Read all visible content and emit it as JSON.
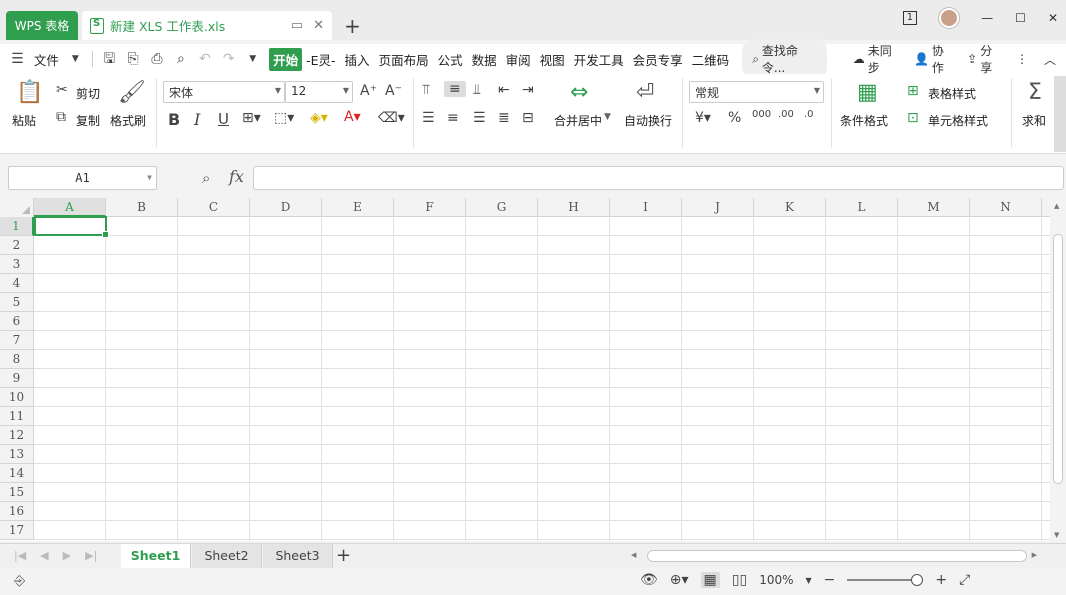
{
  "titlebar": {
    "app_tab": "WPS 表格",
    "doc_tab": "新建 XLS 工作表.xls",
    "tab_count": "1"
  },
  "menubar": {
    "file": "文件",
    "tabs": [
      "开始",
      "-E灵-",
      "插入",
      "页面布局",
      "公式",
      "数据",
      "审阅",
      "视图",
      "开发工具",
      "会员专享",
      "二维码"
    ],
    "search": "查找命令...",
    "sync": "未同步",
    "collab": "协作",
    "share": "分享"
  },
  "ribbon": {
    "paste": "粘贴",
    "cut": "剪切",
    "copy": "复制",
    "format_painter": "格式刷",
    "font_name": "宋体",
    "font_size": "12",
    "merge_center": "合并居中",
    "wrap_text": "自动换行",
    "number_format": "常规",
    "conditional_format": "条件格式",
    "table_style": "表格样式",
    "cell_style": "单元格样式",
    "sum": "求和"
  },
  "formula_bar": {
    "name_box": "A1",
    "fx": "fx"
  },
  "grid": {
    "columns": [
      "A",
      "B",
      "C",
      "D",
      "E",
      "F",
      "G",
      "H",
      "I",
      "J",
      "K",
      "L",
      "M",
      "N"
    ],
    "rows": [
      "1",
      "2",
      "3",
      "4",
      "5",
      "6",
      "7",
      "8",
      "9",
      "10",
      "11",
      "12",
      "13",
      "14",
      "15",
      "16",
      "17"
    ],
    "active_cell": "A1"
  },
  "sheets": [
    "Sheet1",
    "Sheet2",
    "Sheet3"
  ],
  "active_sheet": "Sheet1",
  "statusbar": {
    "zoom": "100%"
  },
  "colors": {
    "accent": "#2f9e4f"
  }
}
